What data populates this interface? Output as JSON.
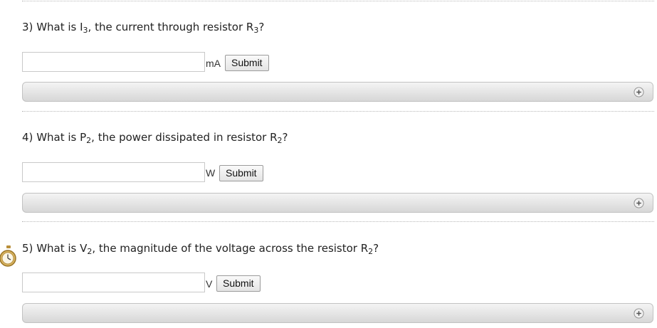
{
  "questions": [
    {
      "number": "3)",
      "text_before": "What is I",
      "sub1": "3",
      "text_middle": ", the current through resistor R",
      "sub2": "3",
      "text_after": "?",
      "input_value": "",
      "unit": "mA",
      "submit_label": "Submit"
    },
    {
      "number": "4)",
      "text_before": "What is P",
      "sub1": "2",
      "text_middle": ", the power dissipated in resistor R",
      "sub2": "2",
      "text_after": "?",
      "input_value": "",
      "unit": "W",
      "submit_label": "Submit"
    },
    {
      "number": "5)",
      "text_before": "What is V",
      "sub1": "2",
      "text_middle": ", the magnitude of the voltage across the resistor R",
      "sub2": "2",
      "text_after": "?",
      "input_value": "",
      "unit": "V",
      "submit_label": "Submit"
    }
  ],
  "icons": {
    "expand": "plus-circle-icon",
    "timer": "stopwatch-icon"
  },
  "colors": {
    "bar_top": "#f4f4f4",
    "bar_bottom": "#d7d7d7",
    "timer_gold": "#c9a14a"
  }
}
